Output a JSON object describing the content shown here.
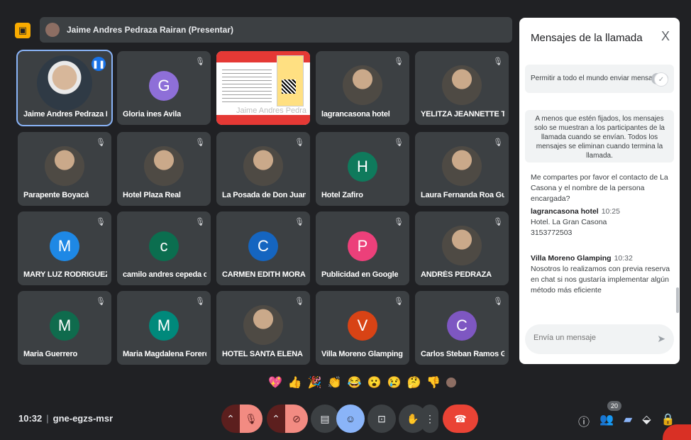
{
  "presenter": {
    "name": "Jaime Andres Pedraza Rairan (Presentar)"
  },
  "tiles": [
    {
      "name": "Jaime Andres Pedraza R...",
      "kind": "photo",
      "speaking": true,
      "active": true
    },
    {
      "name": "Gloria ines Avila",
      "kind": "letter",
      "letter": "G",
      "color": "#8e6fd8",
      "muted": true
    },
    {
      "name": "Jaime Andres Pedra",
      "kind": "slide",
      "muted": false
    },
    {
      "name": "lagrancasona hotel",
      "kind": "photo",
      "muted": true
    },
    {
      "name": "YELITZA JEANNETTE TO...",
      "kind": "photo",
      "muted": true
    },
    {
      "name": "Parapente Boyacá",
      "kind": "photo",
      "muted": true
    },
    {
      "name": "Hotel Plaza Real",
      "kind": "photo",
      "muted": true
    },
    {
      "name": "La Posada de Don Juan",
      "kind": "photo",
      "muted": true
    },
    {
      "name": "Hotel Zafiro",
      "kind": "letter",
      "letter": "H",
      "color": "#0f7a5c",
      "muted": true
    },
    {
      "name": "Laura Fernanda Roa Gue...",
      "kind": "photo",
      "muted": true
    },
    {
      "name": "MARY LUZ RODRIGUEZ V...",
      "kind": "letter",
      "letter": "M",
      "color": "#1e88e5",
      "muted": true
    },
    {
      "name": "camilo andres cepeda ce...",
      "kind": "letter",
      "letter": "c",
      "color": "#0b6e4f",
      "muted": true
    },
    {
      "name": "CARMEN EDITH MORA M...",
      "kind": "letter",
      "letter": "C",
      "color": "#1565c0",
      "muted": true
    },
    {
      "name": "Publicidad en Google",
      "kind": "letter",
      "letter": "P",
      "color": "#ec407a",
      "muted": true
    },
    {
      "name": "ANDRÉS PEDRAZA",
      "kind": "photo",
      "muted": true
    },
    {
      "name": "Maria Guerrero",
      "kind": "letter",
      "letter": "M",
      "color": "#0f6b4d",
      "muted": true
    },
    {
      "name": "Maria Magdalena Forero ...",
      "kind": "letter",
      "letter": "M",
      "color": "#00897b",
      "muted": true
    },
    {
      "name": "HOTEL SANTA ELENA",
      "kind": "photo",
      "muted": true
    },
    {
      "name": "Villa Moreno Glamping",
      "kind": "letter",
      "letter": "V",
      "color": "#d84315",
      "muted": true
    },
    {
      "name": "Carlos Steban Ramos Go...",
      "kind": "letter",
      "letter": "C",
      "color": "#7e57c2",
      "muted": true
    }
  ],
  "reactions": [
    "💖",
    "👍",
    "🎉",
    "👏",
    "😂",
    "😮",
    "😢",
    "🤔",
    "👎"
  ],
  "meeting": {
    "time": "10:32",
    "separator": "|",
    "code": "gne-egzs-msr"
  },
  "people_count": "20",
  "panel": {
    "title": "Mensajes de la llamada",
    "permit_label": "Permitir a todo el mundo enviar mensajes",
    "info": "A menos que estén fijados, los mensajes solo se muestran a los participantes de la llamada cuando se envían. Todos los mensajes se eliminan cuando termina la llamada.",
    "messages": [
      {
        "sender": "",
        "time": "",
        "text": "Me compartes por favor el contacto de La Casona y el nombre de la persona encargada?"
      },
      {
        "sender": "lagrancasona hotel",
        "time": "10:25",
        "text": "Hotel. La Gran Casona",
        "text2": "3153772503"
      },
      {
        "sender": "Villa Moreno Glamping",
        "time": "10:32",
        "text": "Nosotros lo realizamos con previa reserva en chat si nos gustaría implementar algún método más eficiente"
      }
    ],
    "input_placeholder": "Envía un mensaje"
  }
}
